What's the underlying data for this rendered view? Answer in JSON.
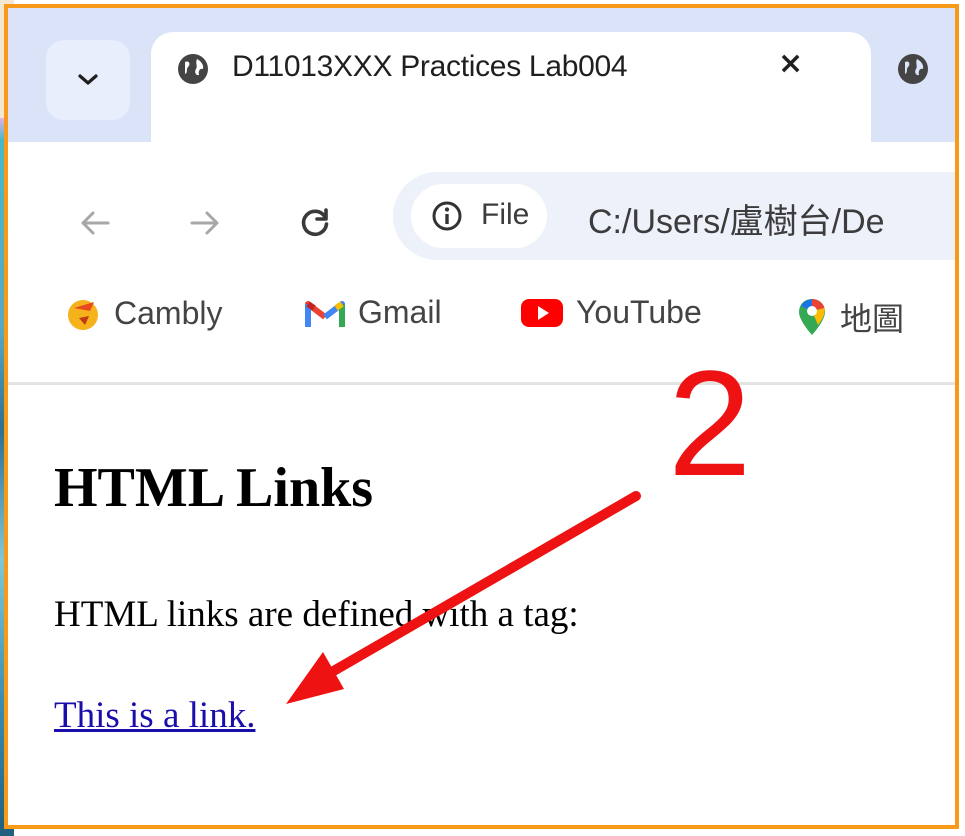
{
  "browser": {
    "tabs": [
      {
        "title": "D11013XXX Practices Lab004",
        "active": true
      },
      {
        "title": "",
        "active": false
      }
    ],
    "tab_close_glyph": "×",
    "address": {
      "security_chip": "File",
      "url": "C:/Users/盧樹台/De"
    },
    "bookmarks": [
      {
        "label": "Cambly",
        "icon": "cambly-icon"
      },
      {
        "label": "Gmail",
        "icon": "gmail-icon"
      },
      {
        "label": "YouTube",
        "icon": "youtube-icon"
      },
      {
        "label": "地圖",
        "icon": "maps-icon"
      }
    ]
  },
  "page": {
    "heading": "HTML Links",
    "paragraph": "HTML links are defined with a tag:",
    "link_text": "This is a link."
  },
  "annotation": {
    "step_number": "2",
    "color": "#ee1212"
  },
  "colors": {
    "frame_border": "#f79a1a",
    "tab_strip": "#dae3f8",
    "link": "#1a0dab"
  }
}
